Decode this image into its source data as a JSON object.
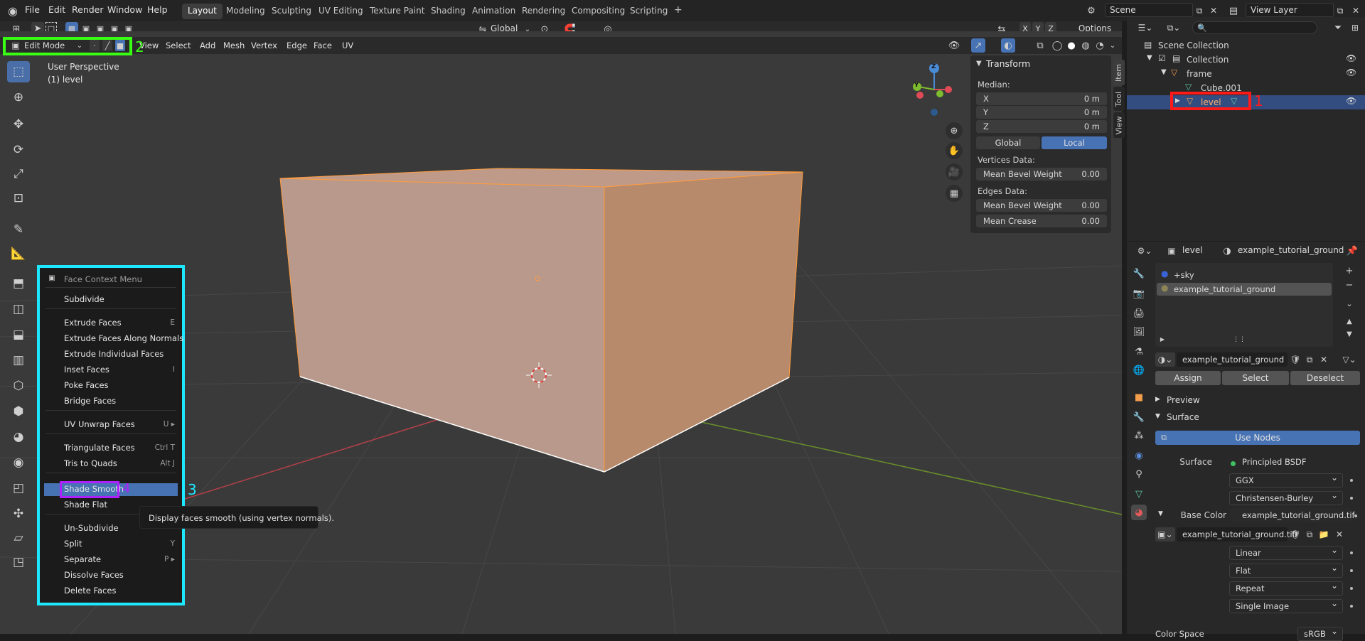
{
  "topbar": {
    "menus": [
      "File",
      "Edit",
      "Render",
      "Window",
      "Help"
    ],
    "workspaces": [
      "Layout",
      "Modeling",
      "Sculpting",
      "UV Editing",
      "Texture Paint",
      "Shading",
      "Animation",
      "Rendering",
      "Compositing",
      "Scripting"
    ],
    "add_tab": "+",
    "scene": "Scene",
    "view_layer": "View Layer"
  },
  "viewport_header": {
    "mode": "Edit Mode",
    "menus": [
      "View",
      "Select",
      "Add",
      "Mesh",
      "Vertex",
      "Edge",
      "Face",
      "UV"
    ],
    "orientation": "Global",
    "axes": [
      "X",
      "Y",
      "Z"
    ],
    "options": "Options"
  },
  "viewport": {
    "perspective": "User Perspective",
    "object": "(1) level"
  },
  "gizmo": {
    "x": "X",
    "y": "Y",
    "z": "Z"
  },
  "npanel": {
    "title": "Transform",
    "median": "Median:",
    "x_label": "X",
    "x_value": "0 m",
    "y_label": "Y",
    "y_value": "0 m",
    "z_label": "Z",
    "z_value": "0 m",
    "global": "Global",
    "local": "Local",
    "vertices_data": "Vertices Data:",
    "vbevel_label": "Mean Bevel Weight",
    "vbevel_value": "0.00",
    "edges_data": "Edges Data:",
    "ebevel_label": "Mean Bevel Weight",
    "ebevel_value": "0.00",
    "crease_label": "Mean Crease",
    "crease_value": "0.00",
    "tabs": [
      "Item",
      "Tool",
      "View"
    ]
  },
  "outliner": {
    "search_placeholder": "",
    "scene_collection": "Scene Collection",
    "collection": "Collection",
    "frame": "frame",
    "cube": "Cube.001",
    "level": "level"
  },
  "properties": {
    "object": "level",
    "material": "example_tutorial_ground",
    "slots": [
      "+sky",
      "example_tutorial_ground"
    ],
    "material_field": "example_tutorial_ground",
    "assign": "Assign",
    "select": "Select",
    "deselect": "Deselect",
    "preview": "Preview",
    "surface_panel": "Surface",
    "use_nodes": "Use Nodes",
    "surface_label": "Surface",
    "surface_value": "Principled BSDF",
    "distribution": "GGX",
    "subsurface": "Christensen-Burley",
    "base_color_label": "Base Color",
    "base_color_value": "example_tutorial_ground.tif",
    "image_field": "example_tutorial_ground.tif",
    "interpolation": "Linear",
    "projection": "Flat",
    "extension": "Repeat",
    "source": "Single Image",
    "color_space_label": "Color Space",
    "color_space_value": "sRGB"
  },
  "context_menu": {
    "title": "Face Context Menu",
    "items": [
      {
        "label": "Subdivide",
        "shortcut": ""
      },
      {
        "label": "Extrude Faces",
        "shortcut": "E"
      },
      {
        "label": "Extrude Faces Along Normals",
        "shortcut": ""
      },
      {
        "label": "Extrude Individual Faces",
        "shortcut": ""
      },
      {
        "label": "Inset Faces",
        "shortcut": "I"
      },
      {
        "label": "Poke Faces",
        "shortcut": ""
      },
      {
        "label": "Bridge Faces",
        "shortcut": ""
      },
      {
        "label": "UV Unwrap Faces",
        "shortcut": "U ▸"
      },
      {
        "label": "Triangulate Faces",
        "shortcut": "Ctrl T"
      },
      {
        "label": "Tris to Quads",
        "shortcut": "Alt J"
      },
      {
        "label": "Shade Smooth",
        "shortcut": ""
      },
      {
        "label": "Shade Flat",
        "shortcut": ""
      },
      {
        "label": "Un-Subdivide",
        "shortcut": ""
      },
      {
        "label": "Split",
        "shortcut": "Y"
      },
      {
        "label": "Separate",
        "shortcut": "P ▸"
      },
      {
        "label": "Dissolve Faces",
        "shortcut": ""
      },
      {
        "label": "Delete Faces",
        "shortcut": ""
      }
    ],
    "tooltip": "Display faces smooth (using vertex normals)."
  },
  "annotations": {
    "n1": "1",
    "n2": "2",
    "n3": "3",
    "n4": "4"
  },
  "colors": {
    "highlight_green": "#39ff14",
    "highlight_cyan": "#1ee8ff",
    "highlight_red": "#ff1a1a",
    "highlight_purple": "#b020ff",
    "selection_blue": "#4772b3",
    "mesh_face": "#b8998c",
    "mesh_side": "#b78a6c"
  }
}
